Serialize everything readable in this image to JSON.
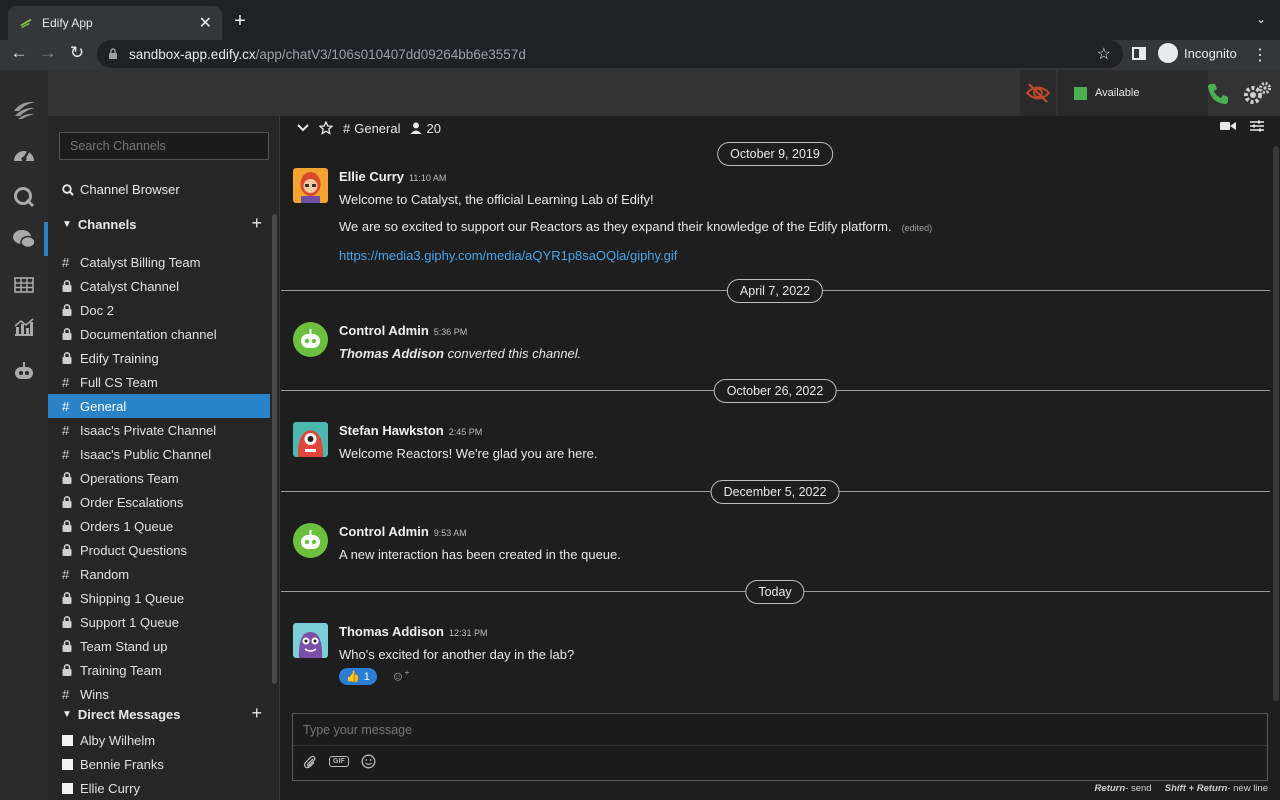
{
  "browser": {
    "tab_title": "Edify App",
    "tab_close": "✕",
    "new_tab": "+",
    "url_host": "sandbox-app.edify.cx",
    "url_path": "/app/chatV3/106s010407dd09264bb6e3557d",
    "incognito_label": "Incognito"
  },
  "topbar": {
    "status_label": "Available",
    "status_color": "#4caf50",
    "accent_color": "#2a82c7"
  },
  "sidebar": {
    "search_placeholder": "Search Channels",
    "channel_browser_label": "Channel Browser",
    "channels_header": "Channels",
    "channels": [
      {
        "label": "Catalyst Billing Team",
        "icon": "hash-icon"
      },
      {
        "label": "Catalyst Channel",
        "icon": "lock-icon"
      },
      {
        "label": "Doc 2",
        "icon": "lock-icon"
      },
      {
        "label": "Documentation channel",
        "icon": "lock-icon"
      },
      {
        "label": "Edify Training",
        "icon": "lock-icon"
      },
      {
        "label": "Full CS Team",
        "icon": "hash-icon"
      },
      {
        "label": "General",
        "icon": "hash-icon",
        "active": true
      },
      {
        "label": "Isaac's Private Channel",
        "icon": "hash-icon"
      },
      {
        "label": "Isaac's Public Channel",
        "icon": "hash-icon"
      },
      {
        "label": "Operations Team",
        "icon": "lock-icon"
      },
      {
        "label": "Order Escalations",
        "icon": "lock-icon"
      },
      {
        "label": "Orders 1 Queue",
        "icon": "lock-icon"
      },
      {
        "label": "Product Questions",
        "icon": "lock-icon"
      },
      {
        "label": "Random",
        "icon": "hash-icon"
      },
      {
        "label": "Shipping 1 Queue",
        "icon": "lock-icon"
      },
      {
        "label": "Support 1 Queue",
        "icon": "lock-icon"
      },
      {
        "label": "Team Stand up",
        "icon": "lock-icon"
      },
      {
        "label": "Training Team",
        "icon": "lock-icon"
      },
      {
        "label": "Wins",
        "icon": "hash-icon"
      }
    ],
    "dm_header": "Direct Messages",
    "dms": [
      "Alby Wilhelm",
      "Bennie Franks",
      "Ellie Curry"
    ]
  },
  "chat": {
    "channel_name": "General",
    "member_count": "20",
    "date_separators": [
      "October 9, 2019",
      "April 7, 2022",
      "October 26, 2022",
      "December 5, 2022",
      "Today"
    ],
    "messages": [
      {
        "sender": "Ellie Curry",
        "time": "11:10 AM",
        "lines": [
          "Welcome to Catalyst, the official Learning Lab of Edify!",
          "We are so excited to support our Reactors as they expand their knowledge of the Edify platform."
        ],
        "edited": "(edited)",
        "link": "https://media3.giphy.com/media/aQYR1p8saOQla/giphy.gif"
      },
      {
        "sender": "Control Admin",
        "time": "5:36 PM",
        "actor": "Thomas Addison",
        "action": "converted this channel."
      },
      {
        "sender": "Stefan Hawkston",
        "time": "2:45 PM",
        "text": "Welcome Reactors! We're glad you are here."
      },
      {
        "sender": "Control Admin",
        "time": "9:53 AM",
        "text": "A new interaction has been created in the queue."
      },
      {
        "sender": "Thomas Addison",
        "time": "12:31 PM",
        "text": "Who's excited for another day in the lab?",
        "reaction_emoji": "👍",
        "reaction_count": "1"
      }
    ],
    "composer_placeholder": "Type your message",
    "gif_label": "GIF",
    "hint_send_key": "Return",
    "hint_send": "- send",
    "hint_newline_key": "Shift + Return",
    "hint_newline": "- new line"
  }
}
